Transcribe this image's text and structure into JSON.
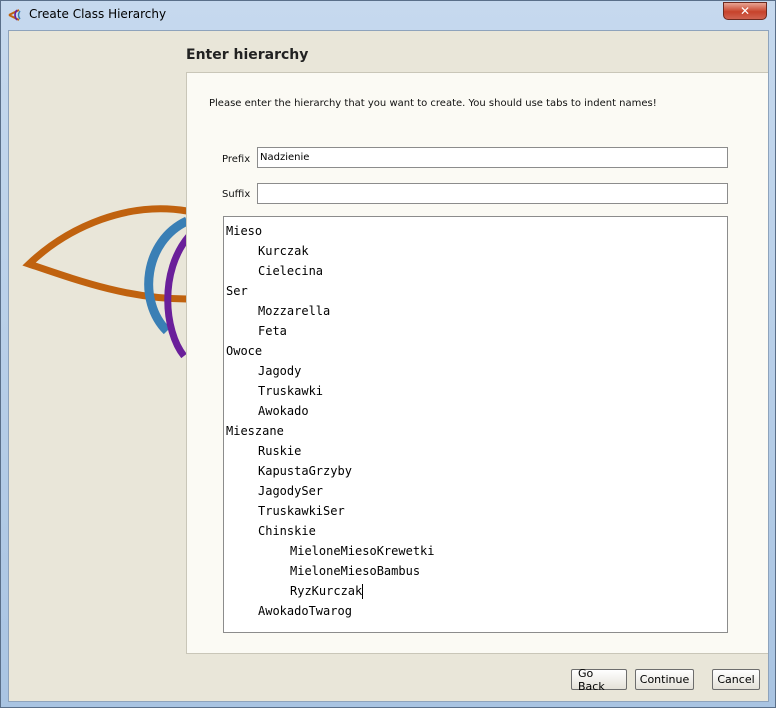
{
  "window": {
    "title": "Create Class Hierarchy",
    "close_label": "✕"
  },
  "page": {
    "heading": "Enter hierarchy",
    "instruction": "Please enter the hierarchy that you want to create.  You should use tabs to indent names!"
  },
  "prefix": {
    "label": "Prefix",
    "value": "Nadzienie"
  },
  "suffix": {
    "label": "Suffix",
    "value": ""
  },
  "hierarchy": {
    "lines": [
      {
        "depth": 0,
        "text": "Mieso"
      },
      {
        "depth": 1,
        "text": "Kurczak"
      },
      {
        "depth": 1,
        "text": "Cielecina"
      },
      {
        "depth": 0,
        "text": "Ser"
      },
      {
        "depth": 1,
        "text": "Mozzarella"
      },
      {
        "depth": 1,
        "text": "Feta"
      },
      {
        "depth": 0,
        "text": "Owoce"
      },
      {
        "depth": 1,
        "text": "Jagody"
      },
      {
        "depth": 1,
        "text": "Truskawki"
      },
      {
        "depth": 1,
        "text": "Awokado"
      },
      {
        "depth": 0,
        "text": "Mieszane"
      },
      {
        "depth": 1,
        "text": "Ruskie"
      },
      {
        "depth": 1,
        "text": "KapustaGrzyby"
      },
      {
        "depth": 1,
        "text": "JagodySer"
      },
      {
        "depth": 1,
        "text": "TruskawkiSer"
      },
      {
        "depth": 1,
        "text": "Chinskie"
      },
      {
        "depth": 2,
        "text": "MieloneMiesoKrewetki"
      },
      {
        "depth": 2,
        "text": "MieloneMiesoBambus"
      },
      {
        "depth": 2,
        "text": "RyzKurczak",
        "caret": true
      },
      {
        "depth": 1,
        "text": "AwokadoTwarog"
      }
    ]
  },
  "buttons": {
    "go_back": "Go Back",
    "continue": "Continue",
    "cancel": "Cancel"
  },
  "colors": {
    "client_bg": "#e9e6d9",
    "logo_orange": "#c0620f",
    "logo_blue": "#3a7fb5",
    "logo_purple": "#6a1f9a"
  },
  "icons": {
    "window": "protege-logo-icon",
    "close": "close-icon"
  }
}
